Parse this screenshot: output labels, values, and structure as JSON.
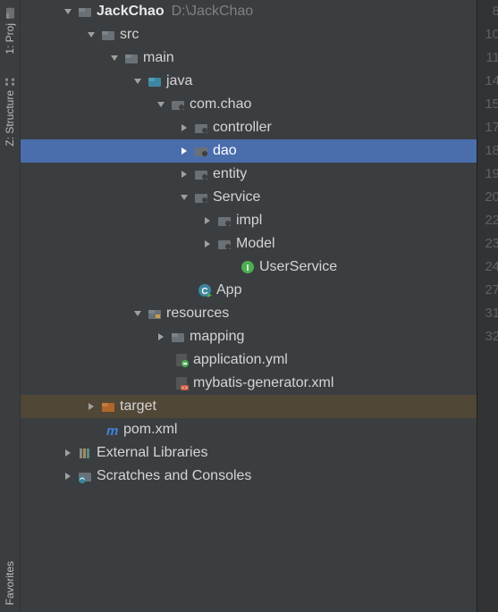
{
  "tabs": {
    "project": "1: Proj",
    "structure": "Z: Structure",
    "favorites": "Favorites"
  },
  "gutter": [
    "",
    "8",
    "",
    "10",
    "11",
    "",
    "",
    "14",
    "15",
    "",
    "17",
    "18",
    "19",
    "20",
    "",
    "22",
    "23",
    "24",
    "",
    "",
    "27",
    "",
    "",
    "",
    "31",
    "32"
  ],
  "tree": [
    {
      "depth": 0,
      "arrow": "down",
      "icon": "module",
      "label": "JackChao",
      "bold": true,
      "extra": "D:\\JackChao"
    },
    {
      "depth": 1,
      "arrow": "down",
      "icon": "folder",
      "label": "src"
    },
    {
      "depth": 2,
      "arrow": "down",
      "icon": "folder",
      "label": "main"
    },
    {
      "depth": 3,
      "arrow": "down",
      "icon": "source-folder",
      "label": "java"
    },
    {
      "depth": 4,
      "arrow": "down",
      "icon": "package",
      "label": "com.chao"
    },
    {
      "depth": 5,
      "arrow": "right",
      "icon": "package",
      "label": "controller"
    },
    {
      "depth": 5,
      "arrow": "right",
      "icon": "package",
      "label": "dao",
      "selected": true
    },
    {
      "depth": 5,
      "arrow": "right",
      "icon": "package",
      "label": "entity"
    },
    {
      "depth": 5,
      "arrow": "down",
      "icon": "package",
      "label": "Service"
    },
    {
      "depth": 6,
      "arrow": "right",
      "icon": "package",
      "label": "impl"
    },
    {
      "depth": 6,
      "arrow": "right",
      "icon": "package",
      "label": "Model"
    },
    {
      "depth": 7,
      "arrow": "",
      "icon": "interface",
      "label": "UserService"
    },
    {
      "depth": 6,
      "offset": -22,
      "arrow": "",
      "icon": "class-run",
      "label": "App"
    },
    {
      "depth": 3,
      "arrow": "down",
      "icon": "resources-folder",
      "label": "resources"
    },
    {
      "depth": 4,
      "arrow": "right",
      "icon": "folder",
      "label": "mapping"
    },
    {
      "depth": 5,
      "offset": -22,
      "arrow": "",
      "icon": "yml",
      "label": "application.yml"
    },
    {
      "depth": 5,
      "offset": -22,
      "arrow": "",
      "icon": "xml",
      "label": "mybatis-generator.xml"
    },
    {
      "depth": 1,
      "arrow": "right",
      "icon": "target-folder",
      "label": "target",
      "highlighted": true
    },
    {
      "depth": 2,
      "offset": -22,
      "arrow": "",
      "icon": "maven",
      "label": "pom.xml"
    },
    {
      "depth": 0,
      "arrow": "right",
      "icon": "ext-libs",
      "label": "External Libraries"
    },
    {
      "depth": 0,
      "arrow": "right",
      "icon": "scratch",
      "label": "Scratches and Consoles"
    }
  ]
}
